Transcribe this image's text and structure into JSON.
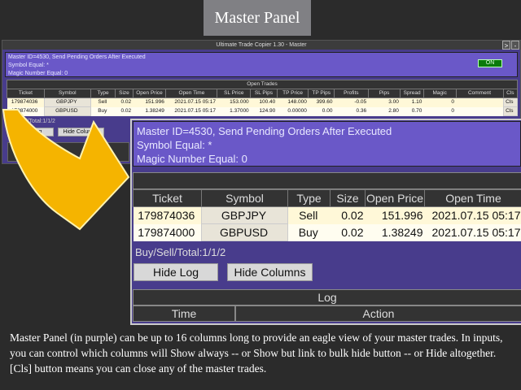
{
  "caption": "Master Panel",
  "window": {
    "title": "Ultimate Trade Copier 1.30 - Master",
    "expand_label": ">",
    "minimize_label": "-"
  },
  "info": {
    "line1": "Master ID=4530, Send Pending Orders After Executed",
    "line2": "Symbol Equal: *",
    "line3": "Magic Number Equal: 0",
    "status": "ON"
  },
  "trades": {
    "title": "Open Trades",
    "columns": [
      "Ticket",
      "Symbol",
      "Type",
      "Size",
      "Open Price",
      "Open Time",
      "SL Price",
      "SL Pips",
      "TP Price",
      "TP Pips",
      "Profits",
      "Pips",
      "Spread",
      "Magic",
      "Comment",
      "Cls"
    ],
    "rows": [
      [
        "179874036",
        "GBPJPY",
        "Sell",
        "0.02",
        "151.996",
        "2021.07.15 05:17",
        "153.000",
        "100.40",
        "148.000",
        "399.60",
        "-0.05",
        "3.00",
        "1.10",
        "0",
        "",
        "Cls"
      ],
      [
        "179874000",
        "GBPUSD",
        "Buy",
        "0.02",
        "1.38249",
        "2021.07.15 05:17",
        "1.37000",
        "124.90",
        "0.00000",
        "0.00",
        "0.36",
        "2.80",
        "0.70",
        "0",
        "",
        "Cls"
      ]
    ]
  },
  "totals": "Buy/Sell/Total:1/1/2",
  "buttons": {
    "hide_log": "Hide Log",
    "hide_columns": "Hide Columns"
  },
  "log": {
    "title": "Log",
    "columns": [
      "Time",
      "Action"
    ]
  },
  "colors": {
    "panel": "#6a58c8",
    "background": "#483c8c",
    "arrow": "#f5b400"
  },
  "description": "Master Panel (in purple) can be up to 16 columns long to provide an eagle view of your master trades. In inputs, you can control which columns will Show always -- or Show but link to bulk hide button -- or Hide altogether.  [Cls] button means you can close any of the master trades."
}
